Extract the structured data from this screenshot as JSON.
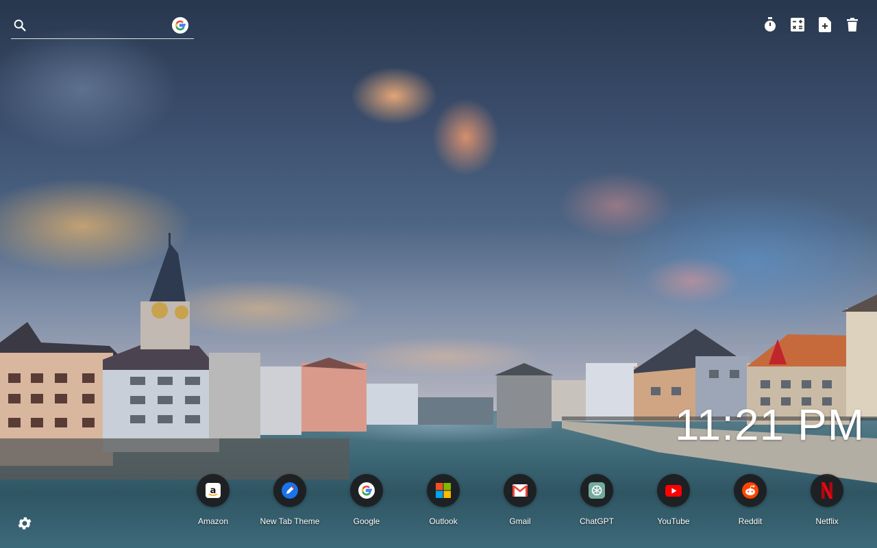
{
  "search": {
    "placeholder": "",
    "icon": "search-icon",
    "engine_icon": "google-g-icon"
  },
  "toolbar": {
    "items": [
      {
        "icon": "stopwatch-icon"
      },
      {
        "icon": "calculator-icon"
      },
      {
        "icon": "add-note-icon"
      },
      {
        "icon": "trash-icon"
      }
    ]
  },
  "clock": {
    "time": "11:21 PM"
  },
  "shortcuts": [
    {
      "label": "Amazon",
      "icon": "amazon-icon"
    },
    {
      "label": "New Tab Theme",
      "icon": "new-tab-theme-icon"
    },
    {
      "label": "Google",
      "icon": "google-icon"
    },
    {
      "label": "Outlook",
      "icon": "microsoft-icon"
    },
    {
      "label": "Gmail",
      "icon": "gmail-icon"
    },
    {
      "label": "ChatGPT",
      "icon": "chatgpt-icon"
    },
    {
      "label": "YouTube",
      "icon": "youtube-icon"
    },
    {
      "label": "Reddit",
      "icon": "reddit-icon"
    },
    {
      "label": "Netflix",
      "icon": "netflix-icon"
    }
  ],
  "settings": {
    "icon": "gear-icon"
  },
  "colors": {
    "amazon": "#ffffff",
    "new_tab_theme": "#1a73e8",
    "gmail_red": "#ea4335",
    "chatgpt": "#74aa9c",
    "youtube": "#ff0000",
    "reddit": "#ff4500",
    "netflix": "#e50914"
  }
}
